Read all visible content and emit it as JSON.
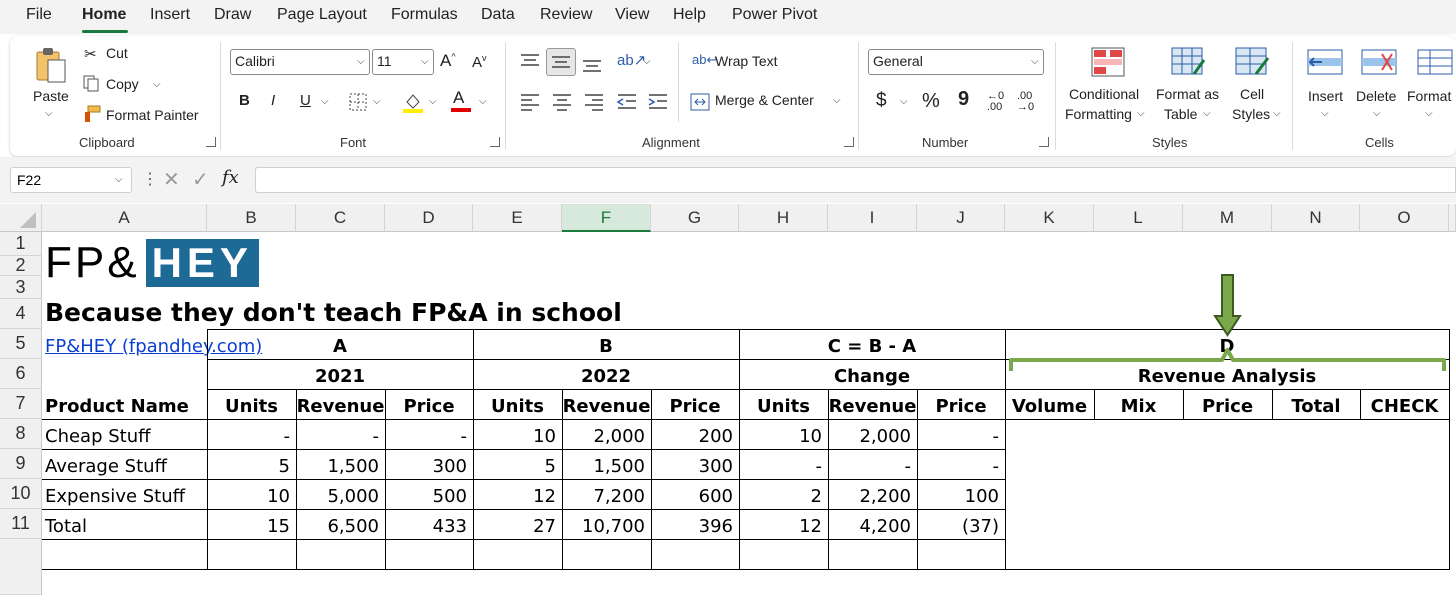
{
  "menu": {
    "items": [
      "File",
      "Home",
      "Insert",
      "Draw",
      "Page Layout",
      "Formulas",
      "Data",
      "Review",
      "View",
      "Help",
      "Power Pivot"
    ]
  },
  "ribbon": {
    "clipboard": {
      "paste": "Paste",
      "cut": "Cut",
      "copy": "Copy",
      "format_painter": "Format Painter",
      "label": "Clipboard"
    },
    "font": {
      "name": "Calibri",
      "size": "11",
      "bold": "B",
      "italic": "I",
      "underline": "U",
      "label": "Font"
    },
    "alignment": {
      "wrap_text": "Wrap Text",
      "merge_center": "Merge & Center",
      "label": "Alignment"
    },
    "number": {
      "format": "General",
      "currency": "$",
      "percent": "%",
      "comma": "9",
      "label": "Number"
    },
    "styles": {
      "conditional_1": "Conditional",
      "conditional_2": "Formatting",
      "format_table_1": "Format as",
      "format_table_2": "Table",
      "cell_styles_1": "Cell",
      "cell_styles_2": "Styles",
      "label": "Styles"
    },
    "cells": {
      "insert": "Insert",
      "delete": "Delete",
      "format": "Format",
      "label": "Cells"
    }
  },
  "formula_bar": {
    "name_box": "F22",
    "fx": "fx",
    "value": ""
  },
  "columns": [
    "A",
    "B",
    "C",
    "D",
    "E",
    "F",
    "G",
    "H",
    "I",
    "J",
    "K",
    "L",
    "M",
    "N",
    "O"
  ],
  "rows": [
    "1",
    "2",
    "3",
    "4",
    "5",
    "6",
    "7",
    "8",
    "9",
    "10",
    "11"
  ],
  "sheet": {
    "logo_fp": "FP&",
    "logo_hey": "HEY",
    "tagline": "Because they don't teach FP&A in school",
    "link": "FP&HEY (fpandhey.com)",
    "group_a": "A",
    "group_b": "B",
    "group_c": "C = B - A",
    "group_d": "D",
    "year_2021": "2021",
    "year_2022": "2022",
    "change": "Change",
    "revenue_analysis": "Revenue Analysis",
    "headers": [
      "Product Name",
      "Units",
      "Revenue",
      "Price",
      "Units",
      "Revenue",
      "Price",
      "Units",
      "Revenue",
      "Price",
      "Volume",
      "Mix",
      "Price",
      "Total",
      "CHECK"
    ],
    "data_rows": [
      [
        "Cheap Stuff",
        "-",
        "-",
        "-",
        "10",
        "2,000",
        "200",
        "10",
        "2,000",
        "-"
      ],
      [
        "Average Stuff",
        "5",
        "1,500",
        "300",
        "5",
        "1,500",
        "300",
        "-",
        "-",
        "-"
      ],
      [
        "Expensive Stuff",
        "10",
        "5,000",
        "500",
        "12",
        "7,200",
        "600",
        "2",
        "2,200",
        "100"
      ],
      [
        "Total",
        "15",
        "6,500",
        "433",
        "27",
        "10,700",
        "396",
        "12",
        "4,200",
        "(37)"
      ]
    ]
  },
  "colors": {
    "accent": "#1a7a3c",
    "logo_bg": "#1e6a96",
    "annotation": "#7aa84a",
    "link": "#0b3fcf"
  }
}
